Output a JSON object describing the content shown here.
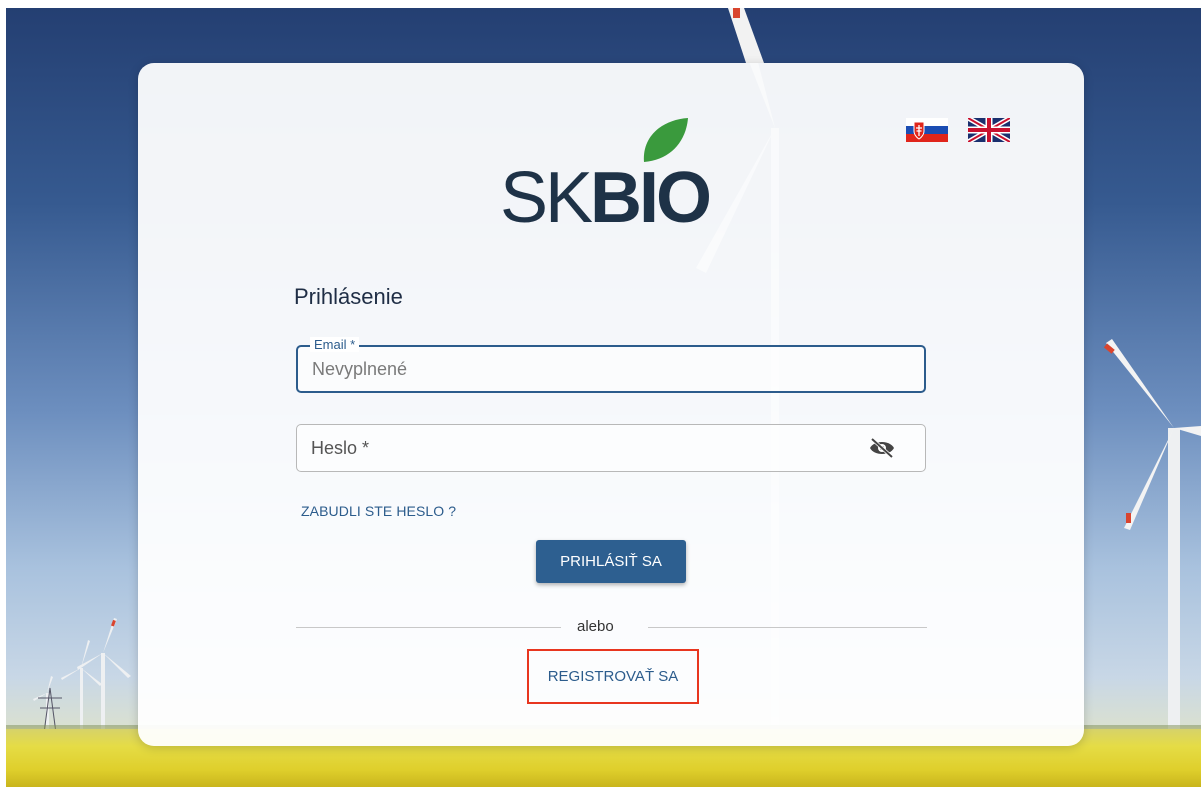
{
  "brand": {
    "logo_sk": "SK",
    "logo_bio": "BIO",
    "leaf_color": "#3a9a3d",
    "text_color": "#1e3247"
  },
  "languages": [
    {
      "code": "sk",
      "icon": "slovakia-flag-icon"
    },
    {
      "code": "en",
      "icon": "uk-flag-icon"
    }
  ],
  "login": {
    "title": "Prihlásenie",
    "email": {
      "label": "Email *",
      "placeholder": "Nevyplnené"
    },
    "password": {
      "label": "Heslo *",
      "toggle_icon": "eye-off-icon"
    },
    "forgot_password": "ZABUDLI STE HESLO ?",
    "submit": "PRIHLÁSIŤ SA",
    "divider_text": "alebo",
    "register": "REGISTROVAŤ SA"
  },
  "colors": {
    "primary": "#2d5f90",
    "highlight_border": "#e8361f"
  }
}
